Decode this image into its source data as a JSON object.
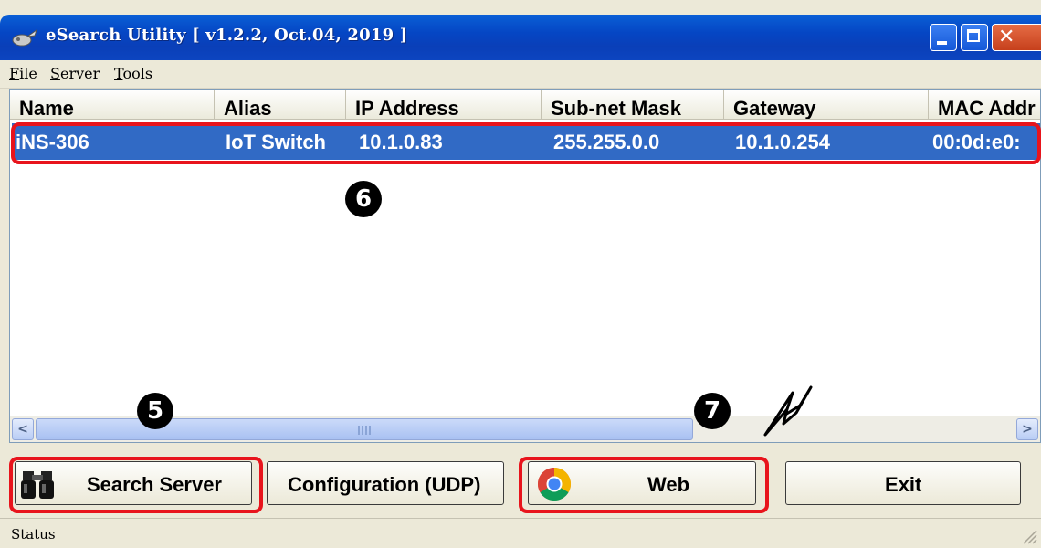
{
  "window": {
    "title": "eSearch Utility [ v1.2.2, Oct.04, 2019 ]"
  },
  "menu": [
    {
      "first": "F",
      "rest": "ile"
    },
    {
      "first": "S",
      "rest": "erver"
    },
    {
      "first": "T",
      "rest": "ools"
    }
  ],
  "columns": [
    "Name",
    "Alias",
    "IP Address",
    "Sub-net Mask",
    "Gateway",
    "MAC Addr"
  ],
  "rows": [
    {
      "name": "iNS-306",
      "alias": "IoT Switch",
      "ip": "10.1.0.83",
      "mask": "255.255.0.0",
      "gateway": "10.1.0.254",
      "mac": "00:0d:e0:"
    }
  ],
  "buttons": {
    "search": "Search Server",
    "config": "Configuration (UDP)",
    "web": "Web",
    "exit": "Exit"
  },
  "annotations": {
    "n5": "5",
    "n6": "6",
    "n7": "7"
  },
  "status": "Status",
  "colors": {
    "titlebar": "#0a4fcf",
    "selection": "#316ac5",
    "highlight": "#e8141c"
  }
}
